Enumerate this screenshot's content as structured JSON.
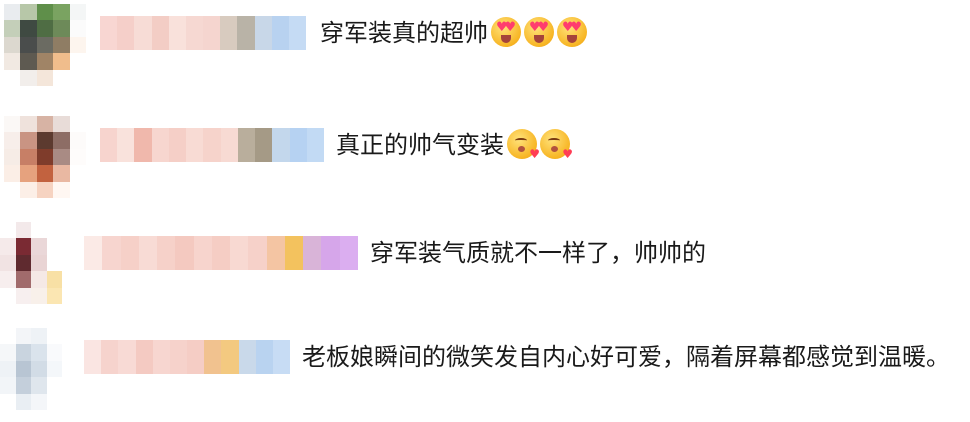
{
  "comments": [
    {
      "text": "穿军装真的超帅",
      "emojis": [
        "heart-eyes-emoji",
        "heart-eyes-emoji",
        "heart-eyes-emoji"
      ]
    },
    {
      "text": "真正的帅气变装",
      "emojis": [
        "kiss-heart-emoji",
        "kiss-heart-emoji"
      ]
    },
    {
      "text": "穿军装气质就不一样了，帅帅的",
      "emojis": []
    },
    {
      "text": "老板娘瞬间的微笑发自内心好可爱，隔着屏幕都感觉到温暖。",
      "emojis": []
    }
  ]
}
